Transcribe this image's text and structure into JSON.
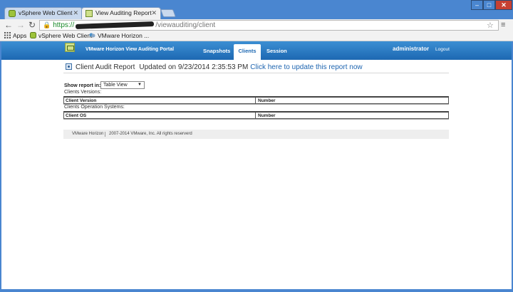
{
  "browser": {
    "tabs": [
      {
        "label": "vSphere Web Client"
      },
      {
        "label": "View Auditing Report"
      }
    ],
    "url": {
      "scheme": "https://",
      "path": "/viewauditing/client"
    },
    "bookmarks": [
      "Apps",
      "vSphere Web Client",
      "VMware Horizon ..."
    ]
  },
  "portal": {
    "title": "VMware Horizon View Auditing Portal",
    "nav": [
      "Snapshots",
      "Clients",
      "Session"
    ],
    "active_nav": "Clients",
    "user": "administrator",
    "logout": "Logout"
  },
  "report": {
    "title": "Client Audit Report",
    "updated": "Updated on 9/23/2014 2:35:53 PM",
    "update_link": "Click here to update this report now",
    "show_label": "Show report in:",
    "view_selected": "Table View",
    "sections": [
      {
        "label": "Clients Versions:",
        "columns": [
          "Client Version",
          "Number"
        ]
      },
      {
        "label": "Clients Operation Systems:",
        "columns": [
          "Client OS",
          "Number"
        ]
      }
    ]
  },
  "footer": {
    "left": "VMware Horizon",
    "right": "2007-2014 VMware, Inc. All rights reserverd"
  }
}
